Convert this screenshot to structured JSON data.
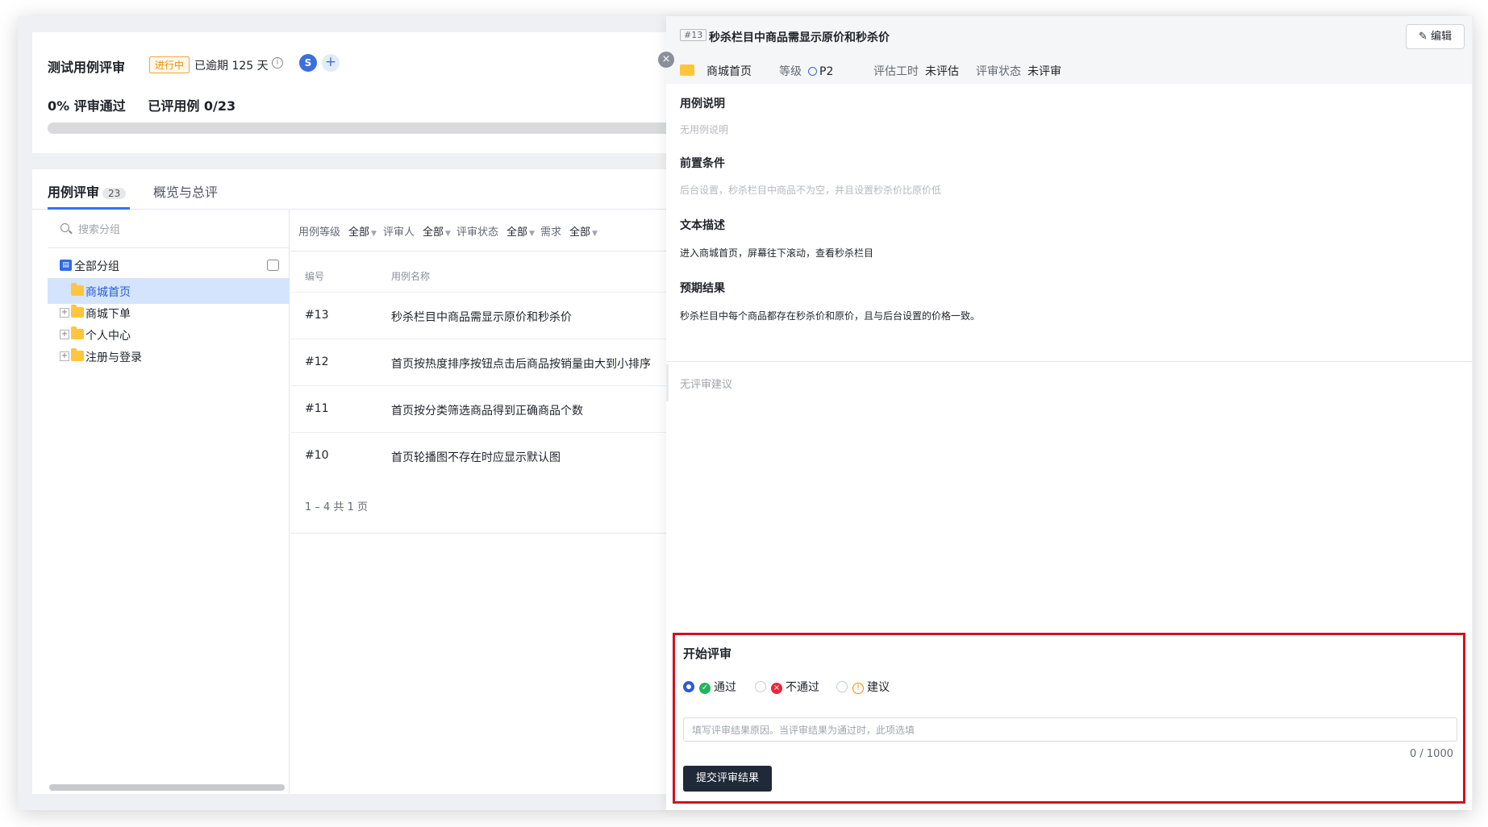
{
  "review": {
    "title": "测试用例评审",
    "status_badge": "进行中",
    "overdue": "已逾期 125 天",
    "avatar_initial": "S",
    "pass_rate": "0% 评审通过",
    "reviewed": "已评用例 0/23"
  },
  "tabs": [
    {
      "label": "用例评审",
      "count": "23"
    },
    {
      "label": "概览与总评"
    }
  ],
  "sidebar": {
    "search_placeholder": "搜索分组",
    "root": "全部分组",
    "items": [
      {
        "label": "商城首页"
      },
      {
        "label": "商城下单"
      },
      {
        "label": "个人中心"
      },
      {
        "label": "注册与登录"
      }
    ]
  },
  "filters": [
    {
      "label": "用例等级",
      "value": "全部"
    },
    {
      "label": "评审人",
      "value": "全部"
    },
    {
      "label": "评审状态",
      "value": "全部"
    },
    {
      "label": "需求",
      "value": "全部"
    }
  ],
  "table": {
    "columns": [
      "编号",
      "用例名称"
    ],
    "rows": [
      {
        "id": "#13",
        "name": "秒杀栏目中商品需显示原价和秒杀价"
      },
      {
        "id": "#12",
        "name": "首页按热度排序按钮点击后商品按销量由大到小排序"
      },
      {
        "id": "#11",
        "name": "首页按分类筛选商品得到正确商品个数"
      },
      {
        "id": "#10",
        "name": "首页轮播图不存在时应显示默认图"
      }
    ],
    "pager": "1 – 4 共 1 页"
  },
  "detail": {
    "case_id": "#13",
    "title": "秒杀栏目中商品需显示原价和秒杀价",
    "edit_label": "编辑",
    "group": "商城首页",
    "level_label": "等级",
    "level_value": "P2",
    "estimate_label": "评估工时",
    "estimate_value": "未评估",
    "review_status_label": "评审状态",
    "review_status_value": "未评审",
    "sections": [
      {
        "title": "用例说明",
        "body": "无用例说明"
      },
      {
        "title": "前置条件",
        "body": "后台设置，秒杀栏目中商品不为空，并且设置秒杀价比原价低"
      },
      {
        "title": "文本描述",
        "body": "进入商城首页，屏幕往下滚动，查看秒杀栏目"
      },
      {
        "title": "预期结果",
        "body": "秒杀栏目中每个商品都存在秒杀价和原价，且与后台设置的价格一致。"
      }
    ],
    "no_suggestion": "无评审建议"
  },
  "review_form": {
    "title": "开始评审",
    "options": [
      "通过",
      "不通过",
      "建议"
    ],
    "selected": "通过",
    "textarea_placeholder": "填写评审结果原因。当评审结果为通过时，此项选填",
    "counter": "0 / 1000",
    "submit_label": "提交评审结果"
  },
  "colors": {
    "accent": "#2a5bd7",
    "pass": "#22b35e",
    "fail": "#e5283a",
    "suggest": "#f08c00",
    "highlight_border": "#d4101f"
  }
}
